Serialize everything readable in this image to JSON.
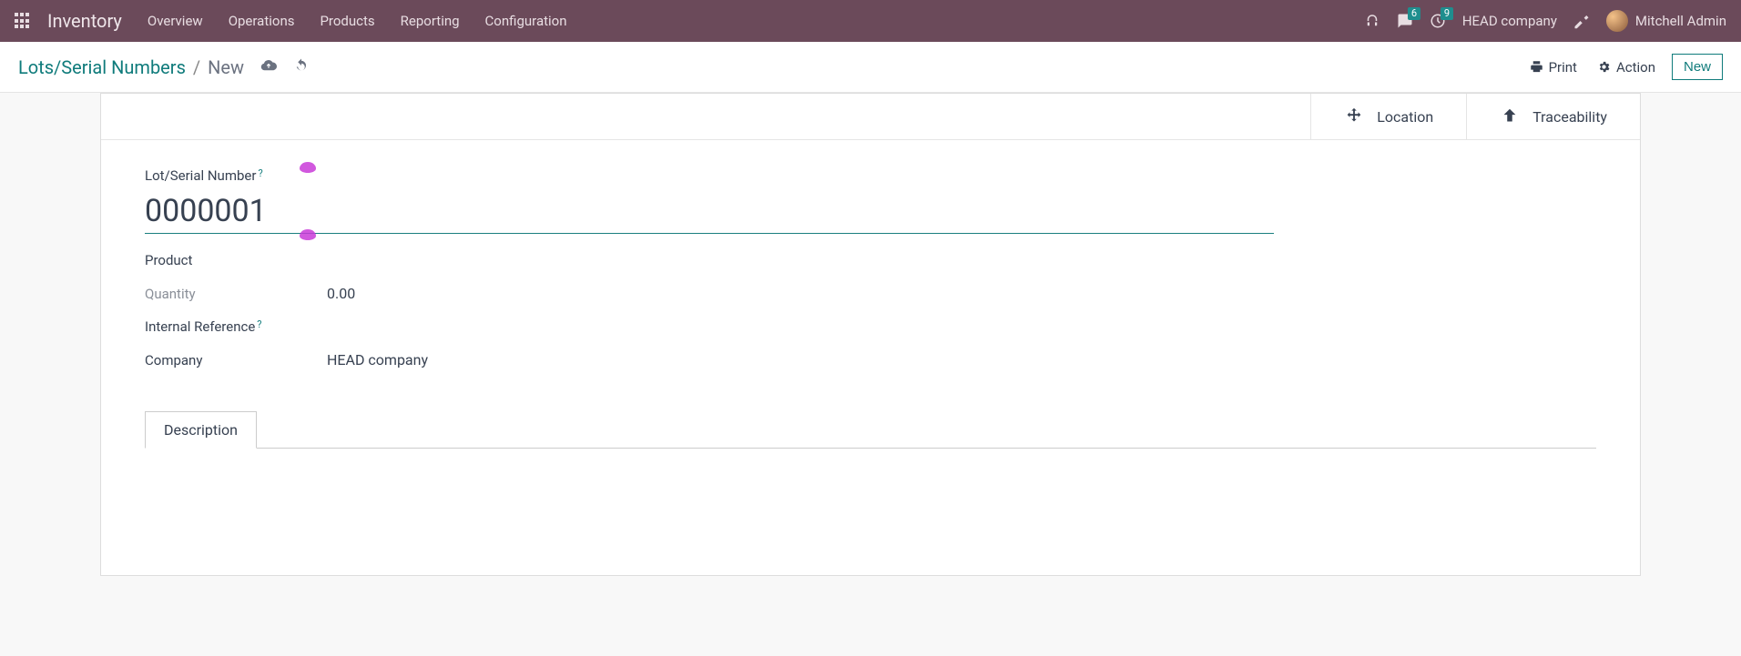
{
  "topbar": {
    "brand": "Inventory",
    "menu": [
      "Overview",
      "Operations",
      "Products",
      "Reporting",
      "Configuration"
    ],
    "messages_badge": "6",
    "activities_badge": "9",
    "company": "HEAD company",
    "user": "Mitchell Admin"
  },
  "controlbar": {
    "breadcrumb_root": "Lots/Serial Numbers",
    "breadcrumb_current": "New",
    "print_label": "Print",
    "action_label": "Action",
    "new_label": "New"
  },
  "stat_buttons": {
    "location": "Location",
    "traceability": "Traceability"
  },
  "form": {
    "lot_label": "Lot/Serial Number",
    "lot_value": "0000001",
    "product_label": "Product",
    "product_value": "",
    "quantity_label": "Quantity",
    "quantity_value": "0.00",
    "internal_ref_label": "Internal Reference",
    "internal_ref_value": "",
    "company_label": "Company",
    "company_value": "HEAD company"
  },
  "tabs": {
    "description": "Description"
  }
}
